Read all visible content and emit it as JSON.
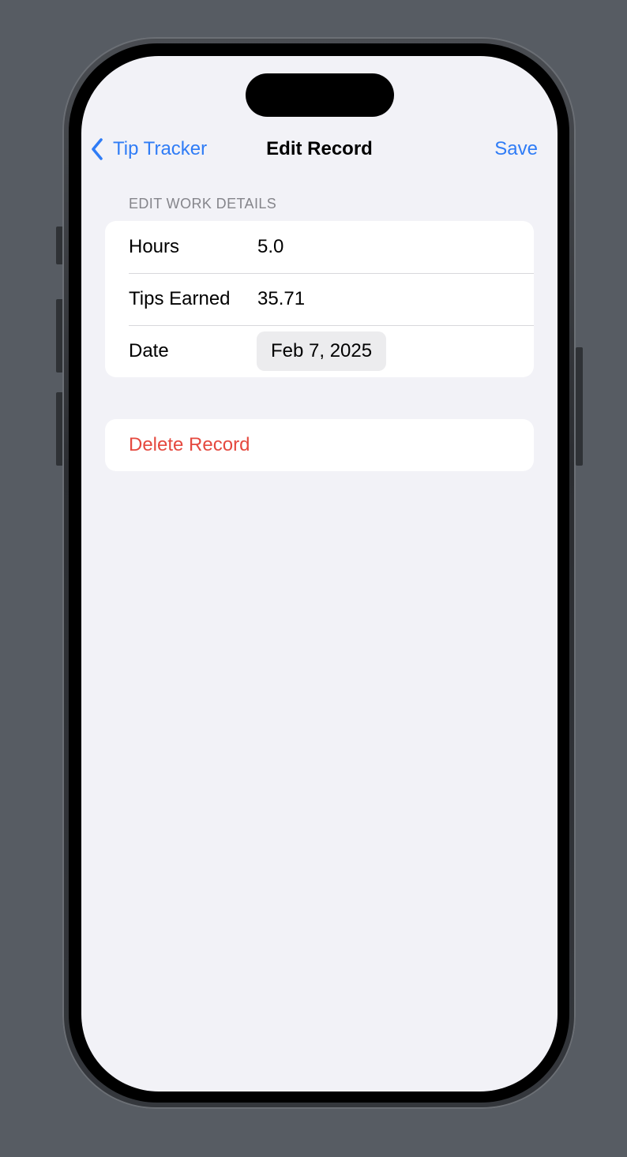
{
  "nav": {
    "back_label": "Tip Tracker",
    "title": "Edit Record",
    "save_label": "Save"
  },
  "section": {
    "header": "EDIT WORK DETAILS"
  },
  "fields": {
    "hours": {
      "label": "Hours",
      "value": "5.0"
    },
    "tips": {
      "label": "Tips Earned",
      "value": "35.71"
    },
    "date": {
      "label": "Date",
      "value": "Feb 7, 2025"
    }
  },
  "actions": {
    "delete_label": "Delete Record"
  },
  "icons": {
    "back": "chevron-left-icon"
  },
  "colors": {
    "accent": "#2f7cf6",
    "destructive": "#e5493f",
    "background": "#f2f2f7",
    "card": "#ffffff",
    "secondary_text": "#85858b"
  }
}
